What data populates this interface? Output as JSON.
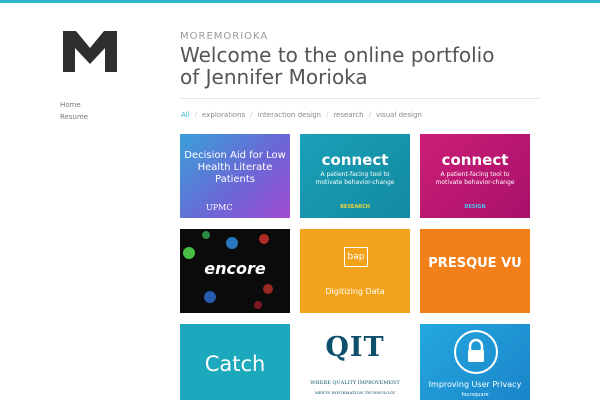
{
  "site": {
    "name": "MOREMORIOKA",
    "headline": "Welcome to the online portfolio of Jennifer Morioka"
  },
  "nav": {
    "items": [
      "Home",
      "Resume"
    ]
  },
  "filters": {
    "active": "All",
    "items": [
      "All",
      "explorations",
      "interaction design",
      "research",
      "visual design"
    ]
  },
  "colors": {
    "accent": "#2bb3c8"
  },
  "tiles": {
    "decision": {
      "title": "Decision Aid for Low Health Literate Patients",
      "logo": "UPMC"
    },
    "connect_research": {
      "title": "connect",
      "subtitle": "A patient-facing tool to motivate behavior-change",
      "tag": "RESEARCH"
    },
    "connect_design": {
      "title": "connect",
      "subtitle": "A patient-facing tool to motivate behavior-change",
      "tag": "DESIGN"
    },
    "encore": {
      "title": "encore"
    },
    "bap": {
      "logo": "bap",
      "title": "Digitizing Data"
    },
    "presque": {
      "title": "PRESQUE VU"
    },
    "catch": {
      "title": "Catch"
    },
    "qit": {
      "logo": "QIT",
      "line1": "WHERE QUALITY IMPROVEMENT",
      "line2": "MEETS INFORMATION TECHNOLOGY"
    },
    "privacy": {
      "title": "Improving User Privacy",
      "brand": "foursquare"
    }
  }
}
